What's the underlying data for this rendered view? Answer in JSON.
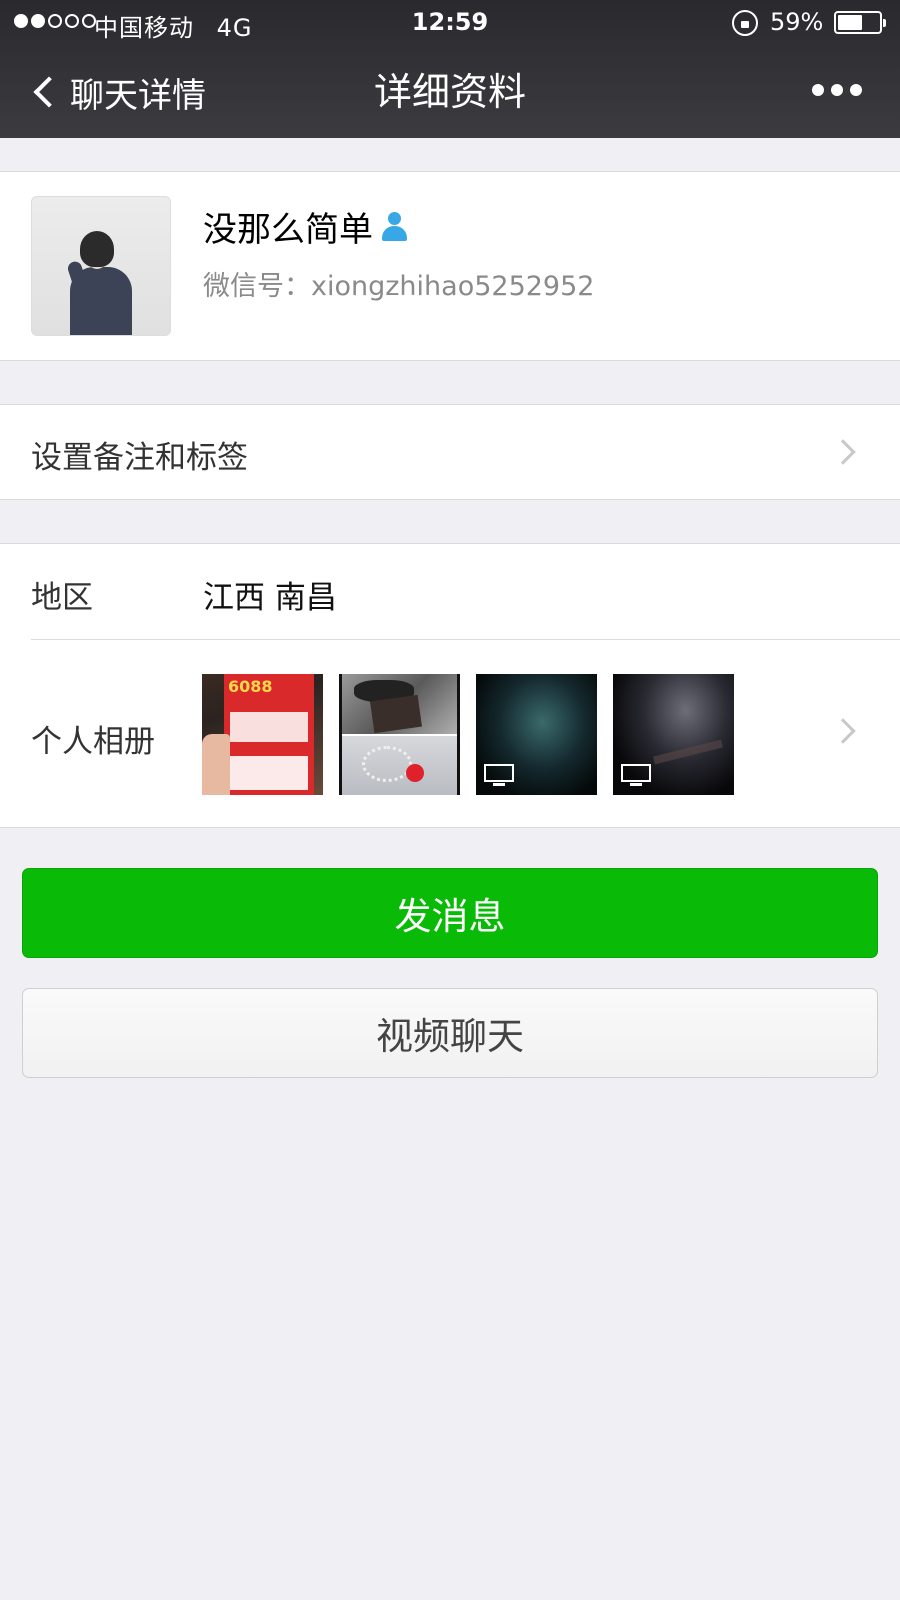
{
  "status_bar": {
    "carrier": "中国移动",
    "network": "4G",
    "time": "12:59",
    "battery_percent": "59%",
    "battery_level": 0.59,
    "signal_bars_filled": 2,
    "signal_bars_total": 5
  },
  "nav": {
    "back_label": "聊天详情",
    "title": "详细资料"
  },
  "profile": {
    "name": "没那么简单",
    "wechat_id": "微信号：xiongzhihao5252952"
  },
  "remark_row": {
    "label": "设置备注和标签"
  },
  "info": {
    "region_label": "地区",
    "region_value": "江西 南昌",
    "album_label": "个人相册",
    "album_thumb1_text": "6088"
  },
  "buttons": {
    "send_message": "发消息",
    "video_chat": "视频聊天"
  },
  "colors": {
    "primary_green": "#09bb07",
    "header_dark": "#333337",
    "background": "#efeff4",
    "verified_icon": "#38a7e6"
  },
  "icons": [
    "signal-dots-icon",
    "lock-rotation-icon",
    "battery-icon",
    "back-chevron-icon",
    "more-icon",
    "person-verified-icon",
    "chevron-right-icon",
    "video-tv-icon"
  ]
}
